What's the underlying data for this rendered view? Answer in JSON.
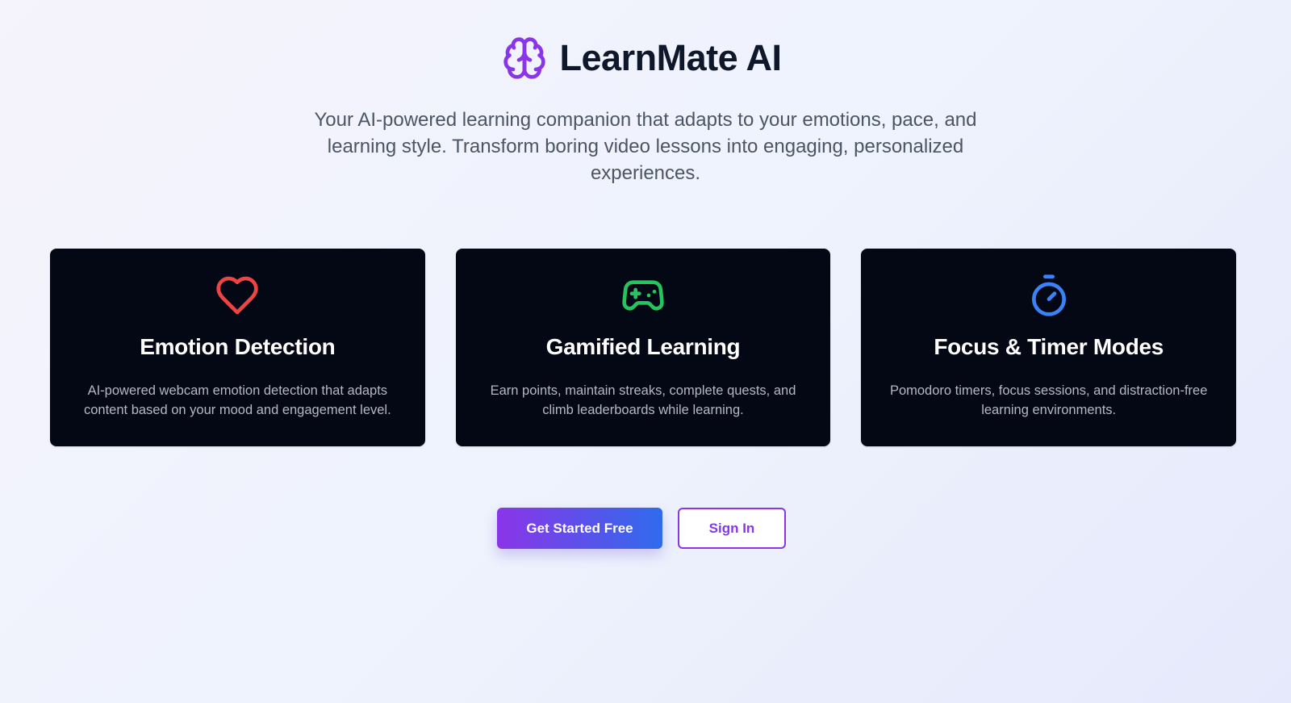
{
  "brand": {
    "title": "LearnMate AI",
    "icon": "brain-icon",
    "accent_color": "#8b35e8"
  },
  "hero": {
    "tagline": "Your AI-powered learning companion that adapts to your emotions, pace, and learning style. Transform boring video lessons into engaging, personalized experiences."
  },
  "features": [
    {
      "icon": "heart-icon",
      "icon_color": "#ef4444",
      "title": "Emotion Detection",
      "description": "AI-powered webcam emotion detection that adapts content based on your mood and engagement level."
    },
    {
      "icon": "gamepad-icon",
      "icon_color": "#22c55e",
      "title": "Gamified Learning",
      "description": "Earn points, maintain streaks, complete quests, and climb leaderboards while learning."
    },
    {
      "icon": "timer-icon",
      "icon_color": "#3b82f6",
      "title": "Focus & Timer Modes",
      "description": "Pomodoro timers, focus sessions, and distraction-free learning environments."
    }
  ],
  "actions": {
    "primary_label": "Get Started Free",
    "secondary_label": "Sign In"
  }
}
